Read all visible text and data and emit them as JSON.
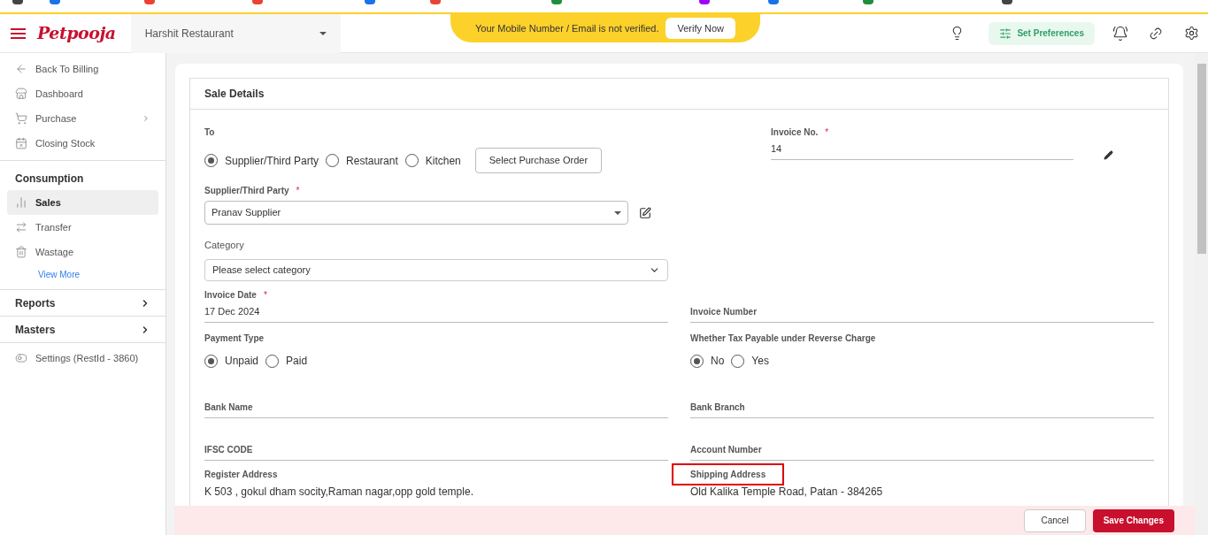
{
  "header": {
    "logo": "Petpooja",
    "restaurant": "Harshit Restaurant",
    "banner": {
      "text": "Your Mobile Number / Email is not verified.",
      "button": "Verify Now"
    },
    "preferences": "Set Preferences"
  },
  "sidebar": {
    "items": [
      {
        "kind": "link",
        "label": "Back To Billing",
        "selected": false,
        "submenu": false
      },
      {
        "kind": "link",
        "label": "Dashboard",
        "selected": false,
        "submenu": false
      },
      {
        "kind": "link",
        "label": "Purchase",
        "selected": false,
        "submenu": true
      },
      {
        "kind": "link",
        "label": "Closing Stock",
        "selected": false,
        "submenu": false
      },
      {
        "kind": "heading",
        "label": "Consumption"
      },
      {
        "kind": "link",
        "label": "Sales",
        "selected": true,
        "submenu": false
      },
      {
        "kind": "link",
        "label": "Transfer",
        "selected": false,
        "submenu": false
      },
      {
        "kind": "link",
        "label": "Wastage",
        "selected": false,
        "submenu": false
      },
      {
        "kind": "more",
        "label": "View More"
      },
      {
        "kind": "group",
        "label": "Reports",
        "expanded": false
      },
      {
        "kind": "group",
        "label": "Masters",
        "expanded": false
      },
      {
        "kind": "link",
        "label": "Settings (RestId - 3860)",
        "selected": false,
        "submenu": false
      }
    ]
  },
  "form": {
    "title": "Sale Details",
    "to": {
      "label": "To",
      "options": [
        {
          "label": "Supplier/Third Party",
          "selected": true
        },
        {
          "label": "Restaurant",
          "selected": false
        },
        {
          "label": "Kitchen",
          "selected": false
        }
      ],
      "button": "Select Purchase Order"
    },
    "invoice_no": {
      "label": "Invoice No.",
      "required_mark": "*",
      "value": "14"
    },
    "supplier": {
      "label": "Supplier/Third Party",
      "required_mark": "*",
      "value": "Pranav Supplier"
    },
    "category": {
      "label": "Category",
      "placeholder": "Please select category"
    },
    "invoice_date": {
      "label": "Invoice Date",
      "required_mark": "*",
      "value": "17 Dec 2024"
    },
    "invoice_number": {
      "label": "Invoice Number"
    },
    "payment_type": {
      "label": "Payment Type",
      "options": [
        {
          "label": "Unpaid",
          "selected": true
        },
        {
          "label": "Paid",
          "selected": false
        }
      ]
    },
    "reverse_charge": {
      "label": "Whether Tax Payable under Reverse Charge",
      "options": [
        {
          "label": "No",
          "selected": true
        },
        {
          "label": "Yes",
          "selected": false
        }
      ]
    },
    "bank_name": {
      "label": "Bank Name"
    },
    "bank_branch": {
      "label": "Bank Branch"
    },
    "ifsc": {
      "label": "IFSC CODE"
    },
    "account_number": {
      "label": "Account Number"
    },
    "register_address": {
      "label": "Register Address",
      "value": "K 503 , gokul dham socity,Raman nagar,opp gold temple.",
      "highlighted": false
    },
    "shipping_address": {
      "label": "Shipping Address",
      "value": "Old Kalika Temple Road, Patan - 384265",
      "highlighted": true
    }
  },
  "footer": {
    "buttons": [
      {
        "kind": "secondary",
        "label": "Cancel"
      },
      {
        "kind": "primary",
        "label": "Save Changes"
      }
    ]
  }
}
